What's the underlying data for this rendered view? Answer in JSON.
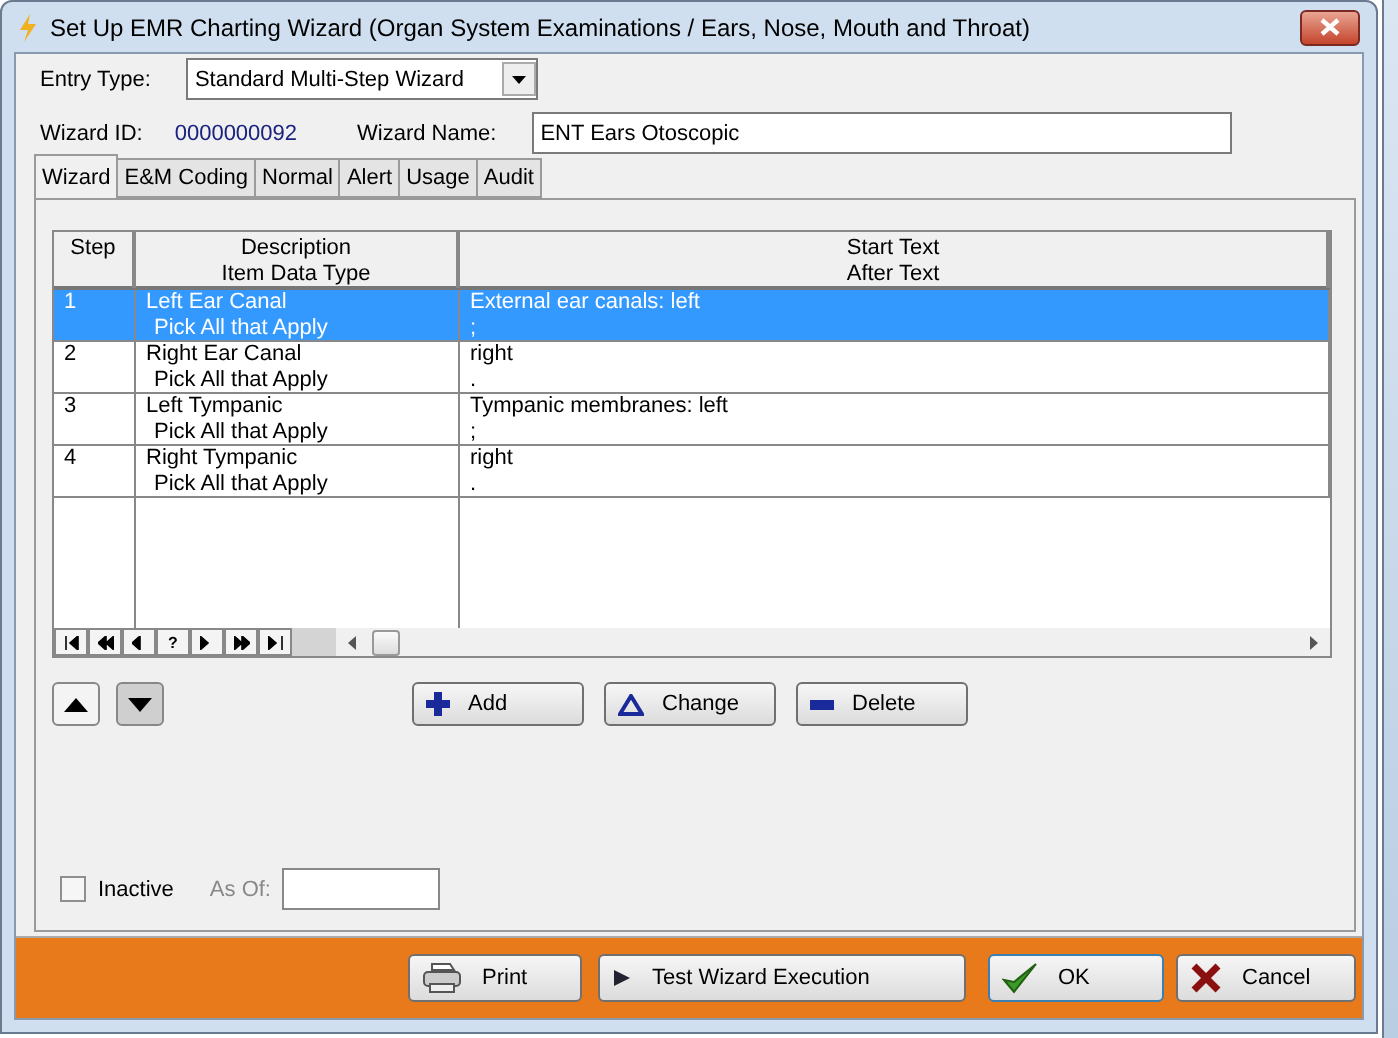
{
  "window": {
    "title": "Set Up EMR Charting Wizard (Organ System Examinations / Ears, Nose, Mouth and Throat)"
  },
  "entry_type": {
    "label": "Entry Type:",
    "value": "Standard Multi-Step Wizard"
  },
  "wizard_id": {
    "label": "Wizard ID:",
    "value": "0000000092"
  },
  "wizard_name": {
    "label": "Wizard Name:",
    "value": "ENT Ears Otoscopic"
  },
  "tabs": [
    {
      "label": "Wizard",
      "selected": true
    },
    {
      "label": "E&M Coding",
      "selected": false
    },
    {
      "label": "Normal",
      "selected": false
    },
    {
      "label": "Alert",
      "selected": false
    },
    {
      "label": "Usage",
      "selected": false
    },
    {
      "label": "Audit",
      "selected": false
    }
  ],
  "table": {
    "columns": [
      [
        "Step"
      ],
      [
        "Description",
        "Item Data Type"
      ],
      [
        "Start Text",
        "After Text"
      ]
    ],
    "rows": [
      {
        "step": "1",
        "description": "Left Ear Canal",
        "item_data_type": "Pick All that Apply",
        "start_text": "External ear canals:  left",
        "after_text": ";",
        "selected": true
      },
      {
        "step": "2",
        "description": "Right Ear Canal",
        "item_data_type": "Pick All that Apply",
        "start_text": "right",
        "after_text": ".",
        "selected": false
      },
      {
        "step": "3",
        "description": "Left Tympanic",
        "item_data_type": "Pick All that Apply",
        "start_text": "Tympanic membranes:  left",
        "after_text": ";",
        "selected": false
      },
      {
        "step": "4",
        "description": "Right Tympanic",
        "item_data_type": "Pick All that Apply",
        "start_text": "right",
        "after_text": ".",
        "selected": false
      }
    ],
    "navigator": [
      "?"
    ]
  },
  "actions": [
    {
      "kind": "add",
      "label": "Add"
    },
    {
      "kind": "change",
      "label": "Change"
    },
    {
      "kind": "delete",
      "label": "Delete"
    }
  ],
  "inactive": {
    "label": "Inactive",
    "checked": false
  },
  "as_of": {
    "label": "As Of:"
  },
  "footer_buttons": [
    {
      "kind": "print",
      "label": "Print"
    },
    {
      "kind": "test",
      "label": "Test Wizard Execution"
    },
    {
      "kind": "ok",
      "label": "OK"
    },
    {
      "kind": "cancel",
      "label": "Cancel"
    }
  ]
}
